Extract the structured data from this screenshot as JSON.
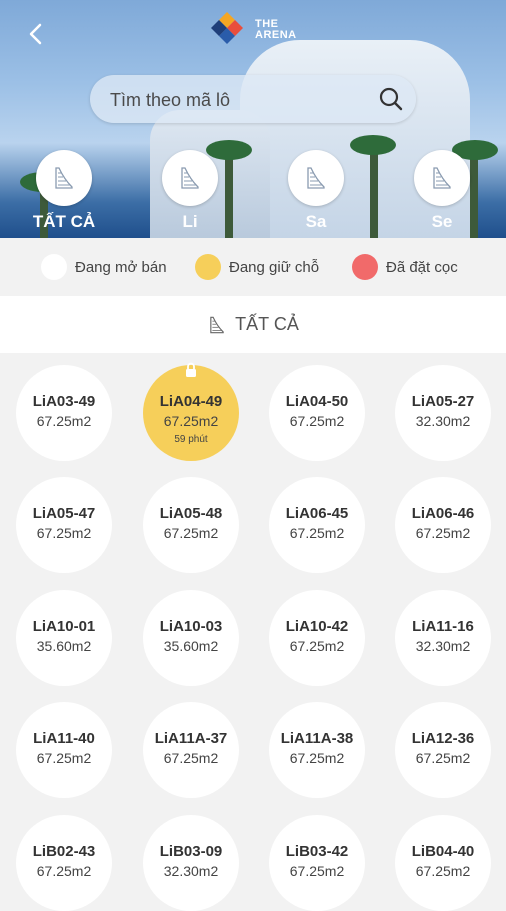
{
  "header": {
    "logo_line1": "THE",
    "logo_line2": "ARENA"
  },
  "search": {
    "placeholder": "Tìm theo mã lô"
  },
  "filters": [
    {
      "label": "TẤT CẢ",
      "icon": "building-icon"
    },
    {
      "label": "Li",
      "icon": "building-icon"
    },
    {
      "label": "Sa",
      "icon": "building-icon"
    },
    {
      "label": "Se",
      "icon": "building-icon"
    }
  ],
  "legend": [
    {
      "label": "Đang mở bán",
      "color": "#ffffff"
    },
    {
      "label": "Đang giữ chỗ",
      "color": "#f6cf5a"
    },
    {
      "label": "Đã đặt cọc",
      "color": "#f16a6a"
    }
  ],
  "section": {
    "title": "TẤT CẢ"
  },
  "lots": [
    {
      "code": "LiA03-49",
      "area": "67.25m2",
      "status": "open"
    },
    {
      "code": "LiA04-49",
      "area": "67.25m2",
      "status": "held",
      "timer": "59 phút"
    },
    {
      "code": "LiA04-50",
      "area": "67.25m2",
      "status": "open"
    },
    {
      "code": "LiA05-27",
      "area": "32.30m2",
      "status": "open"
    },
    {
      "code": "LiA05-47",
      "area": "67.25m2",
      "status": "open"
    },
    {
      "code": "LiA05-48",
      "area": "67.25m2",
      "status": "open"
    },
    {
      "code": "LiA06-45",
      "area": "67.25m2",
      "status": "open"
    },
    {
      "code": "LiA06-46",
      "area": "67.25m2",
      "status": "open"
    },
    {
      "code": "LiA10-01",
      "area": "35.60m2",
      "status": "open"
    },
    {
      "code": "LiA10-03",
      "area": "35.60m2",
      "status": "open"
    },
    {
      "code": "LiA10-42",
      "area": "67.25m2",
      "status": "open"
    },
    {
      "code": "LiA11-16",
      "area": "32.30m2",
      "status": "open"
    },
    {
      "code": "LiA11-40",
      "area": "67.25m2",
      "status": "open"
    },
    {
      "code": "LiA11A-37",
      "area": "67.25m2",
      "status": "open"
    },
    {
      "code": "LiA11A-38",
      "area": "67.25m2",
      "status": "open"
    },
    {
      "code": "LiA12-36",
      "area": "67.25m2",
      "status": "open"
    },
    {
      "code": "LiB02-43",
      "area": "67.25m2",
      "status": "open"
    },
    {
      "code": "LiB03-09",
      "area": "32.30m2",
      "status": "open"
    },
    {
      "code": "LiB03-42",
      "area": "67.25m2",
      "status": "open"
    },
    {
      "code": "LiB04-40",
      "area": "67.25m2",
      "status": "open"
    }
  ]
}
